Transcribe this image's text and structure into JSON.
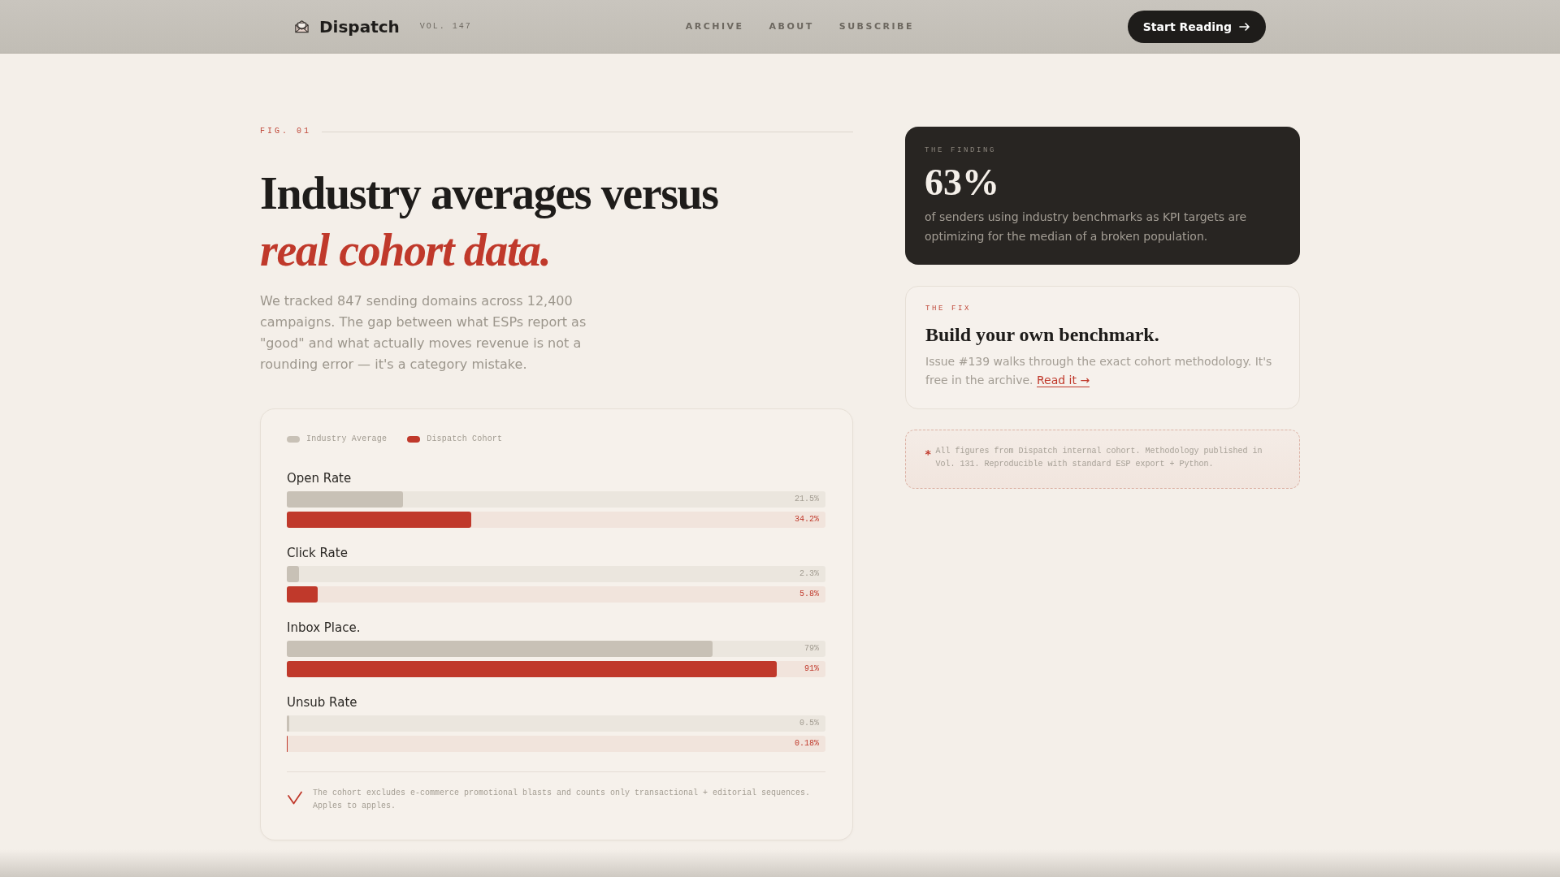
{
  "header": {
    "logo": "Dispatch",
    "volume": "VOL. 147",
    "nav": [
      {
        "label": "ARCHIVE"
      },
      {
        "label": "ABOUT"
      },
      {
        "label": "SUBSCRIBE"
      }
    ],
    "cta": "Start Reading"
  },
  "intro": {
    "figure_label": "FIG. 01",
    "headline": "Industry averages versus",
    "headline_accent": "real cohort data.",
    "lede": "We tracked 847 sending domains across 12,400 campaigns. The gap between what ESPs report as \"good\" and what actually moves revenue is not a rounding error — it's a category mistake."
  },
  "comparison": {
    "legend": [
      {
        "label": "Industry Average",
        "color": "#c8c1b6"
      },
      {
        "label": "Dispatch Cohort",
        "color": "#c0392b"
      }
    ],
    "metrics": [
      {
        "label": "Open Rate",
        "bars": [
          {
            "level": 0.215,
            "reading": "21.5%"
          },
          {
            "level": 0.342,
            "reading": "34.2%"
          }
        ]
      },
      {
        "label": "Click Rate",
        "bars": [
          {
            "level": 0.023,
            "reading": "2.3%"
          },
          {
            "level": 0.058,
            "reading": "5.8%"
          }
        ]
      },
      {
        "label": "Inbox Place.",
        "bars": [
          {
            "level": 0.79,
            "reading": "79%"
          },
          {
            "level": 0.91,
            "reading": "91%"
          }
        ]
      },
      {
        "label": "Unsub Rate",
        "bars": [
          {
            "level": 0.005,
            "reading": "0.5%"
          },
          {
            "level": 0.0018,
            "reading": "0.18%"
          }
        ]
      }
    ],
    "note": "The cohort excludes e-commerce promotional blasts and counts only transactional + editorial sequences. Apples to apples."
  },
  "finding": {
    "label": "THE FINDING",
    "stat": "63%",
    "text": "of senders using industry benchmarks as KPI targets are optimizing for the median of a broken population."
  },
  "fix": {
    "label": "THE FIX",
    "title": "Build your own benchmark.",
    "text": "Issue #139 walks through the exact cohort methodology. It's free in the archive.",
    "link": "Read it →"
  },
  "source_note": {
    "marker": "*",
    "text": "All figures from Dispatch internal cohort. Methodology published in Vol. 131. Reproducible with standard ESP export + Python."
  }
}
